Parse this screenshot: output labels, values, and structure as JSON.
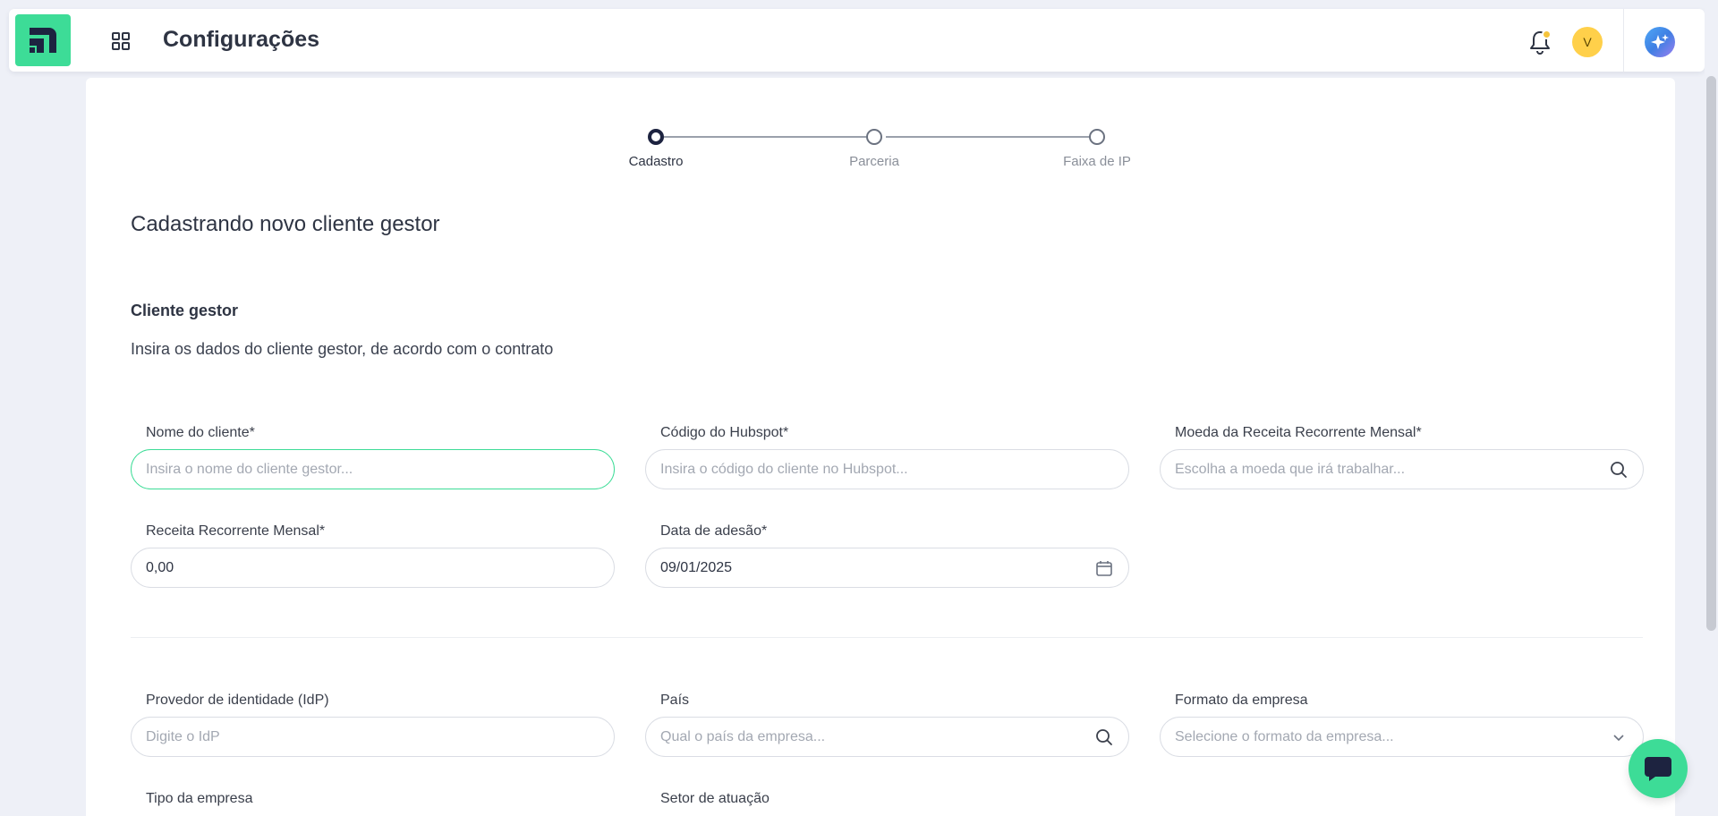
{
  "app": {
    "title": "Configurações",
    "avatar_initial": "V",
    "brand_color": "#3ddc97",
    "notification_badge_color": "#f5c33b"
  },
  "stepper": {
    "steps": [
      {
        "label": "Cadastro",
        "active": true
      },
      {
        "label": "Parceria",
        "active": false
      },
      {
        "label": "Faixa de IP",
        "active": false
      }
    ]
  },
  "form": {
    "heading": "Cadastrando novo cliente gestor",
    "section_title": "Cliente gestor",
    "section_desc": "Insira os dados do cliente gestor, de acordo com o contrato",
    "fields": {
      "client_name": {
        "label": "Nome do cliente*",
        "placeholder": "Insira o nome do cliente gestor...",
        "value": ""
      },
      "hubspot_code": {
        "label": "Código do Hubspot*",
        "placeholder": "Insira o código do cliente no Hubspot...",
        "value": ""
      },
      "currency": {
        "label": "Moeda da Receita Recorrente Mensal*",
        "placeholder": "Escolha a moeda que irá trabalhar...",
        "icon": "search-icon"
      },
      "mrr": {
        "label": "Receita Recorrente Mensal*",
        "value": "0,00"
      },
      "join_date": {
        "label": "Data de adesão*",
        "value": "09/01/2025",
        "icon": "calendar-icon"
      },
      "idp": {
        "label": "Provedor de identidade (IdP)",
        "placeholder": "Digite o IdP",
        "value": ""
      },
      "country": {
        "label": "País",
        "placeholder": "Qual o país da empresa...",
        "icon": "search-icon"
      },
      "company_format": {
        "label": "Formato da empresa",
        "placeholder": "Selecione o formato da empresa...",
        "icon": "chevron-down-icon"
      },
      "company_type": {
        "label": "Tipo da empresa"
      },
      "sector": {
        "label": "Setor de atuação"
      }
    }
  }
}
